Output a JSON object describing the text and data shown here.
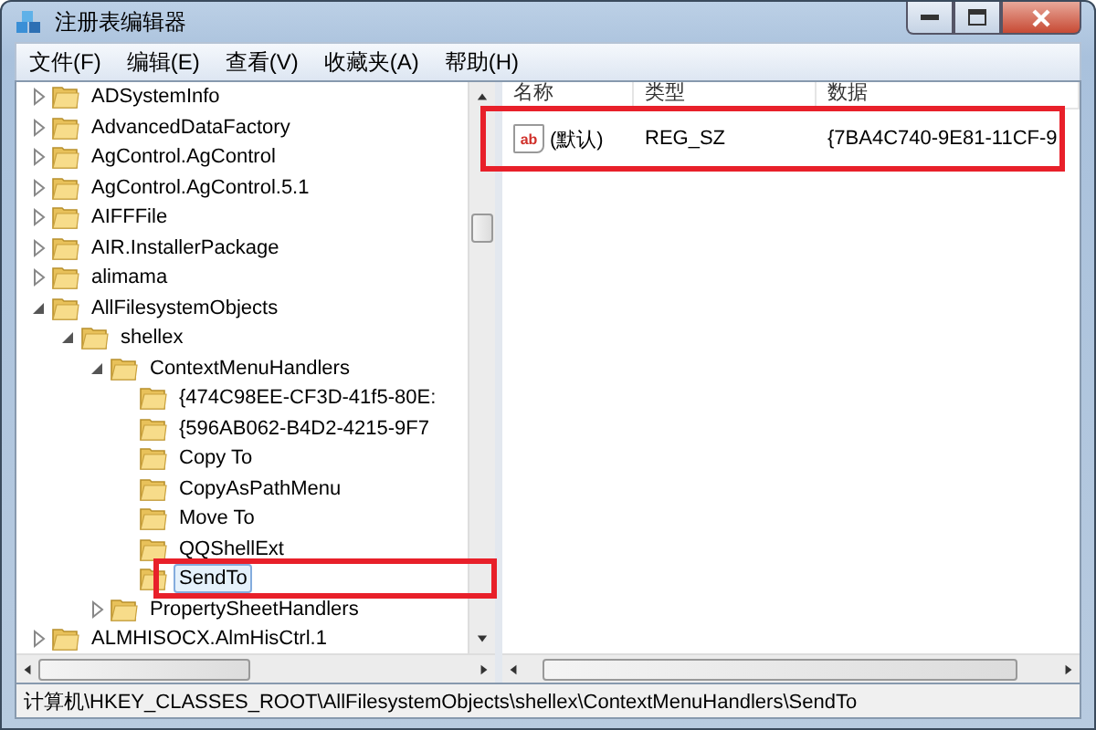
{
  "window": {
    "title": "注册表编辑器"
  },
  "menu": [
    {
      "label": "文件(F)"
    },
    {
      "label": "编辑(E)"
    },
    {
      "label": "查看(V)"
    },
    {
      "label": "收藏夹(A)"
    },
    {
      "label": "帮助(H)"
    }
  ],
  "tree": [
    {
      "label": "ADSystemInfo",
      "expanded": false,
      "selected": false
    },
    {
      "label": "AdvancedDataFactory",
      "expanded": false,
      "selected": false
    },
    {
      "label": "AgControl.AgControl",
      "expanded": false,
      "selected": false
    },
    {
      "label": "AgControl.AgControl.5.1",
      "expanded": false,
      "selected": false
    },
    {
      "label": "AIFFFile",
      "expanded": false,
      "selected": false
    },
    {
      "label": "AIR.InstallerPackage",
      "expanded": false,
      "selected": false
    },
    {
      "label": "alimama",
      "expanded": false,
      "selected": false
    },
    {
      "label": "AllFilesystemObjects",
      "expanded": true,
      "selected": false,
      "children": [
        {
          "label": "shellex",
          "expanded": true,
          "selected": false,
          "children": [
            {
              "label": "ContextMenuHandlers",
              "expanded": true,
              "selected": false,
              "children": [
                {
                  "label": "{474C98EE-CF3D-41f5-80E:",
                  "selected": false
                },
                {
                  "label": "{596AB062-B4D2-4215-9F7",
                  "selected": false
                },
                {
                  "label": "Copy To",
                  "selected": false
                },
                {
                  "label": "CopyAsPathMenu",
                  "selected": false
                },
                {
                  "label": "Move To",
                  "selected": false
                },
                {
                  "label": "QQShellExt",
                  "selected": false
                },
                {
                  "label": "SendTo",
                  "selected": true
                }
              ]
            },
            {
              "label": "PropertySheetHandlers",
              "expanded": false,
              "selected": false
            }
          ]
        }
      ]
    },
    {
      "label": "ALMHISOCX.AlmHisCtrl.1",
      "expanded": false,
      "selected": false
    }
  ],
  "values": {
    "columns": [
      "名称",
      "类型",
      "数据"
    ],
    "rows": [
      {
        "icon_text": "ab",
        "name": "(默认)",
        "type": "REG_SZ",
        "data": "{7BA4C740-9E81-11CF-9",
        "selected": false
      }
    ]
  },
  "status_bar": "计算机\\HKEY_CLASSES_ROOT\\AllFilesystemObjects\\shellex\\ContextMenuHandlers\\SendTo"
}
